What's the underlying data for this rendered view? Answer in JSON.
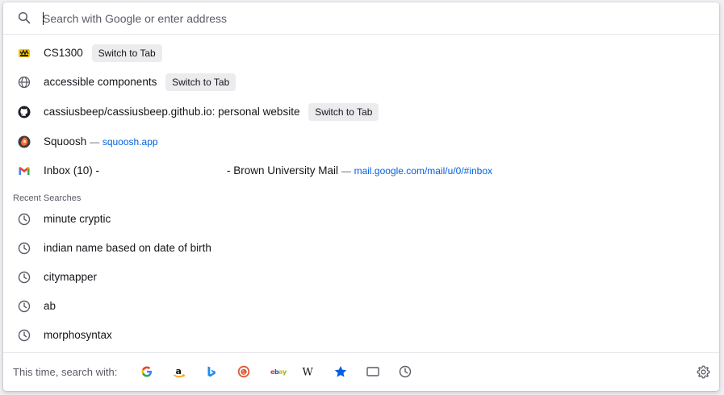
{
  "urlbar": {
    "placeholder": "Search with Google or enter address",
    "value": ""
  },
  "results": [
    {
      "title": "CS1300",
      "action": "Switch to Tab",
      "icon": "cs1300-favicon"
    },
    {
      "title": "accessible components",
      "action": "Switch to Tab",
      "icon": "globe-icon"
    },
    {
      "title": "cassiusbeep/cassiusbeep.github.io: personal website",
      "action": "Switch to Tab",
      "icon": "github-icon"
    },
    {
      "title": "Squoosh",
      "separator": "—",
      "url": "squoosh.app",
      "icon": "squoosh-icon"
    },
    {
      "title_start": "Inbox (10) -",
      "title_end": "- Brown University Mail",
      "separator": "—",
      "url": "mail.google.com/mail/u/0/#inbox",
      "icon": "gmail-icon"
    }
  ],
  "recent_searches": {
    "label": "Recent Searches",
    "items": [
      "minute cryptic",
      "indian name based on date of birth",
      "citymapper",
      "ab",
      "morphosyntax"
    ]
  },
  "footer": {
    "label": "This time, search with:",
    "engines": [
      "google-icon",
      "amazon-icon",
      "bing-icon",
      "duckduckgo-icon",
      "ebay-icon",
      "wikipedia-icon",
      "bookmarks-icon",
      "tabs-icon",
      "history-icon"
    ]
  },
  "colors": {
    "accent": "#0061e0",
    "text": "#15141a",
    "muted": "#5b5b66",
    "switch_bg": "#ececef"
  }
}
